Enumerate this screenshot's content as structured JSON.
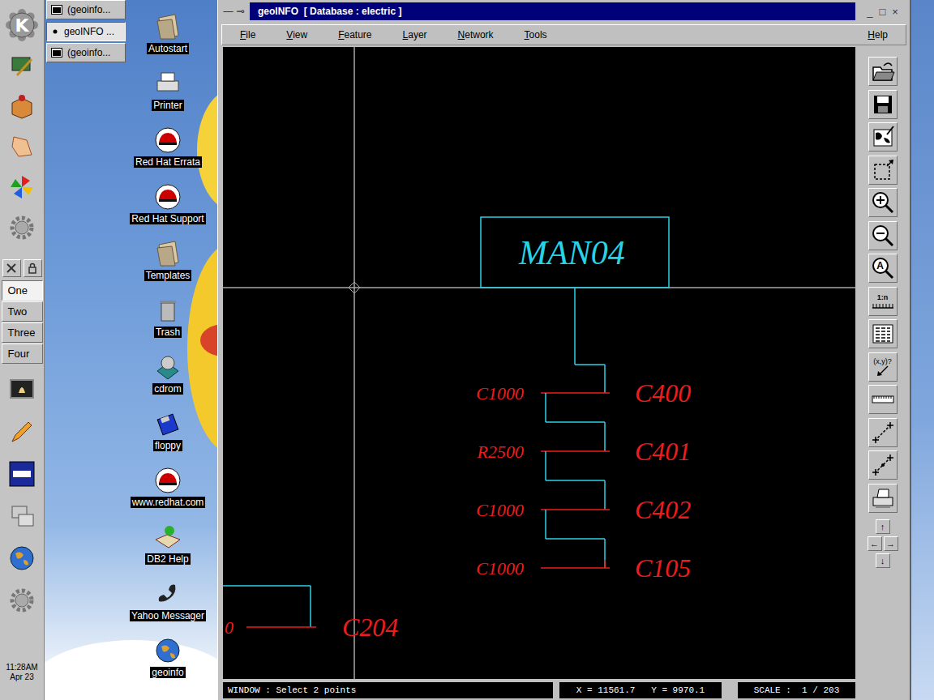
{
  "panel": {
    "logo": "K",
    "pager": [
      {
        "label": "One",
        "selected": true
      },
      {
        "label": "Two",
        "selected": false
      },
      {
        "label": "Three",
        "selected": false
      },
      {
        "label": "Four",
        "selected": false
      }
    ],
    "clock": {
      "time": "11:28AM",
      "date": "Apr 23"
    }
  },
  "taskbar": [
    {
      "label": "(geoinfo...",
      "selected": false
    },
    {
      "label": "geoINFO ...",
      "selected": true
    },
    {
      "label": "(geoinfo...",
      "selected": false
    }
  ],
  "desktop_icons": [
    {
      "label": "Autostart"
    },
    {
      "label": "Printer"
    },
    {
      "label": "Red Hat Errata"
    },
    {
      "label": "Red Hat Support"
    },
    {
      "label": "Templates"
    },
    {
      "label": "Trash"
    },
    {
      "label": "cdrom"
    },
    {
      "label": "floppy"
    },
    {
      "label": "www.redhat.com"
    },
    {
      "label": "DB2 Help"
    },
    {
      "label": "Yahoo Messager"
    },
    {
      "label": "geoinfo"
    }
  ],
  "window": {
    "title": "geoINFO  [ Database : electric ]",
    "buttons_left": [
      "—",
      "⊸"
    ],
    "buttons_right": [
      "_",
      "□",
      "×"
    ]
  },
  "menu": [
    "File",
    "View",
    "Feature",
    "Layer",
    "Network",
    "Tools",
    "Help"
  ],
  "diagram": {
    "box": "MAN04",
    "rows": [
      {
        "left": "C1000",
        "right": "C400"
      },
      {
        "left": "R2500",
        "right": "C401"
      },
      {
        "left": "C1000",
        "right": "C402"
      },
      {
        "left": "C1000",
        "right": "C105"
      }
    ],
    "partial": {
      "left": "0",
      "right": "C204"
    }
  },
  "toolbar": {
    "scale_label": "1:n",
    "coords_label": "(x,y)?",
    "zoom_all_label": "A",
    "arrows": [
      "↑",
      "←",
      "→",
      "↓"
    ]
  },
  "status_bar": {
    "prompt": "WINDOW : Select 2 points",
    "coords": "X = 11561.7   Y = 9970.1",
    "scale": "SCALE :  1 / 203"
  }
}
